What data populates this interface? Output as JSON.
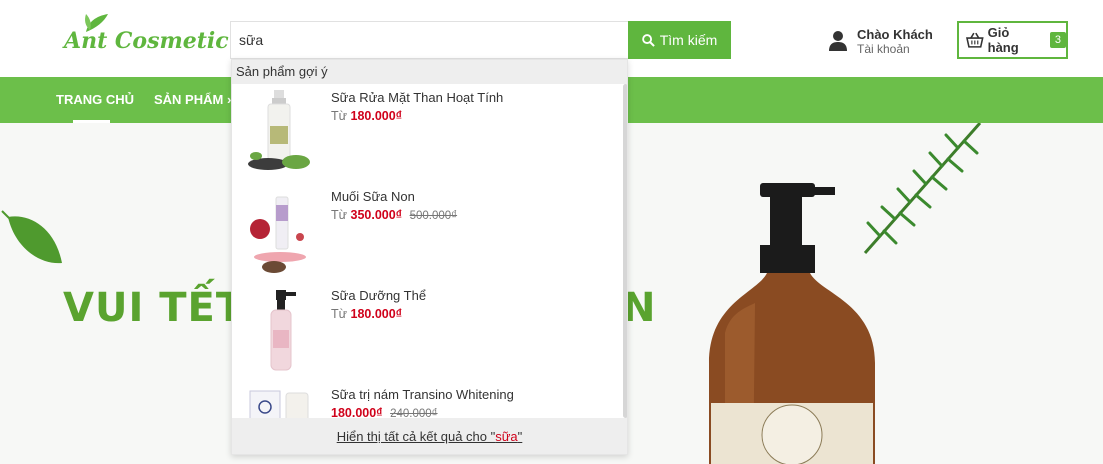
{
  "brand": {
    "logo_text": "Ant Cosmetic",
    "accent": "#5fb63e"
  },
  "search": {
    "value": "sữa",
    "button_label": "Tìm kiếm",
    "button_icon": "search-icon"
  },
  "account": {
    "greeting": "Chào Khách",
    "sub": "Tài khoản",
    "icon": "user-icon"
  },
  "cart": {
    "label": "Giỏ hàng",
    "count": "3",
    "icon": "basket-icon"
  },
  "nav": {
    "home": "TRANG CHỦ",
    "products": "SẢN PHẨM ›"
  },
  "banner": {
    "text_left": "VUI TẾT",
    "text_right": "N"
  },
  "suggest": {
    "heading": "Sản phẩm gợi ý",
    "items": [
      {
        "name": "Sữa Rửa Mặt Than Hoạt Tính",
        "prefix": "Từ",
        "price": "180.000₫",
        "old_price": ""
      },
      {
        "name": "Muối Sữa Non",
        "prefix": "Từ",
        "price": "350.000₫",
        "old_price": "500.000₫"
      },
      {
        "name": "Sữa Dưỡng Thể",
        "prefix": "Từ",
        "price": "180.000₫",
        "old_price": ""
      },
      {
        "name": "Sữa trị nám Transino Whitening",
        "prefix": "",
        "price": "180.000₫",
        "old_price": "240.000₫"
      }
    ],
    "footer_prefix": "Hiển thị tất cả kết quả cho \"",
    "footer_keyword": "sữa",
    "footer_suffix": "\""
  }
}
